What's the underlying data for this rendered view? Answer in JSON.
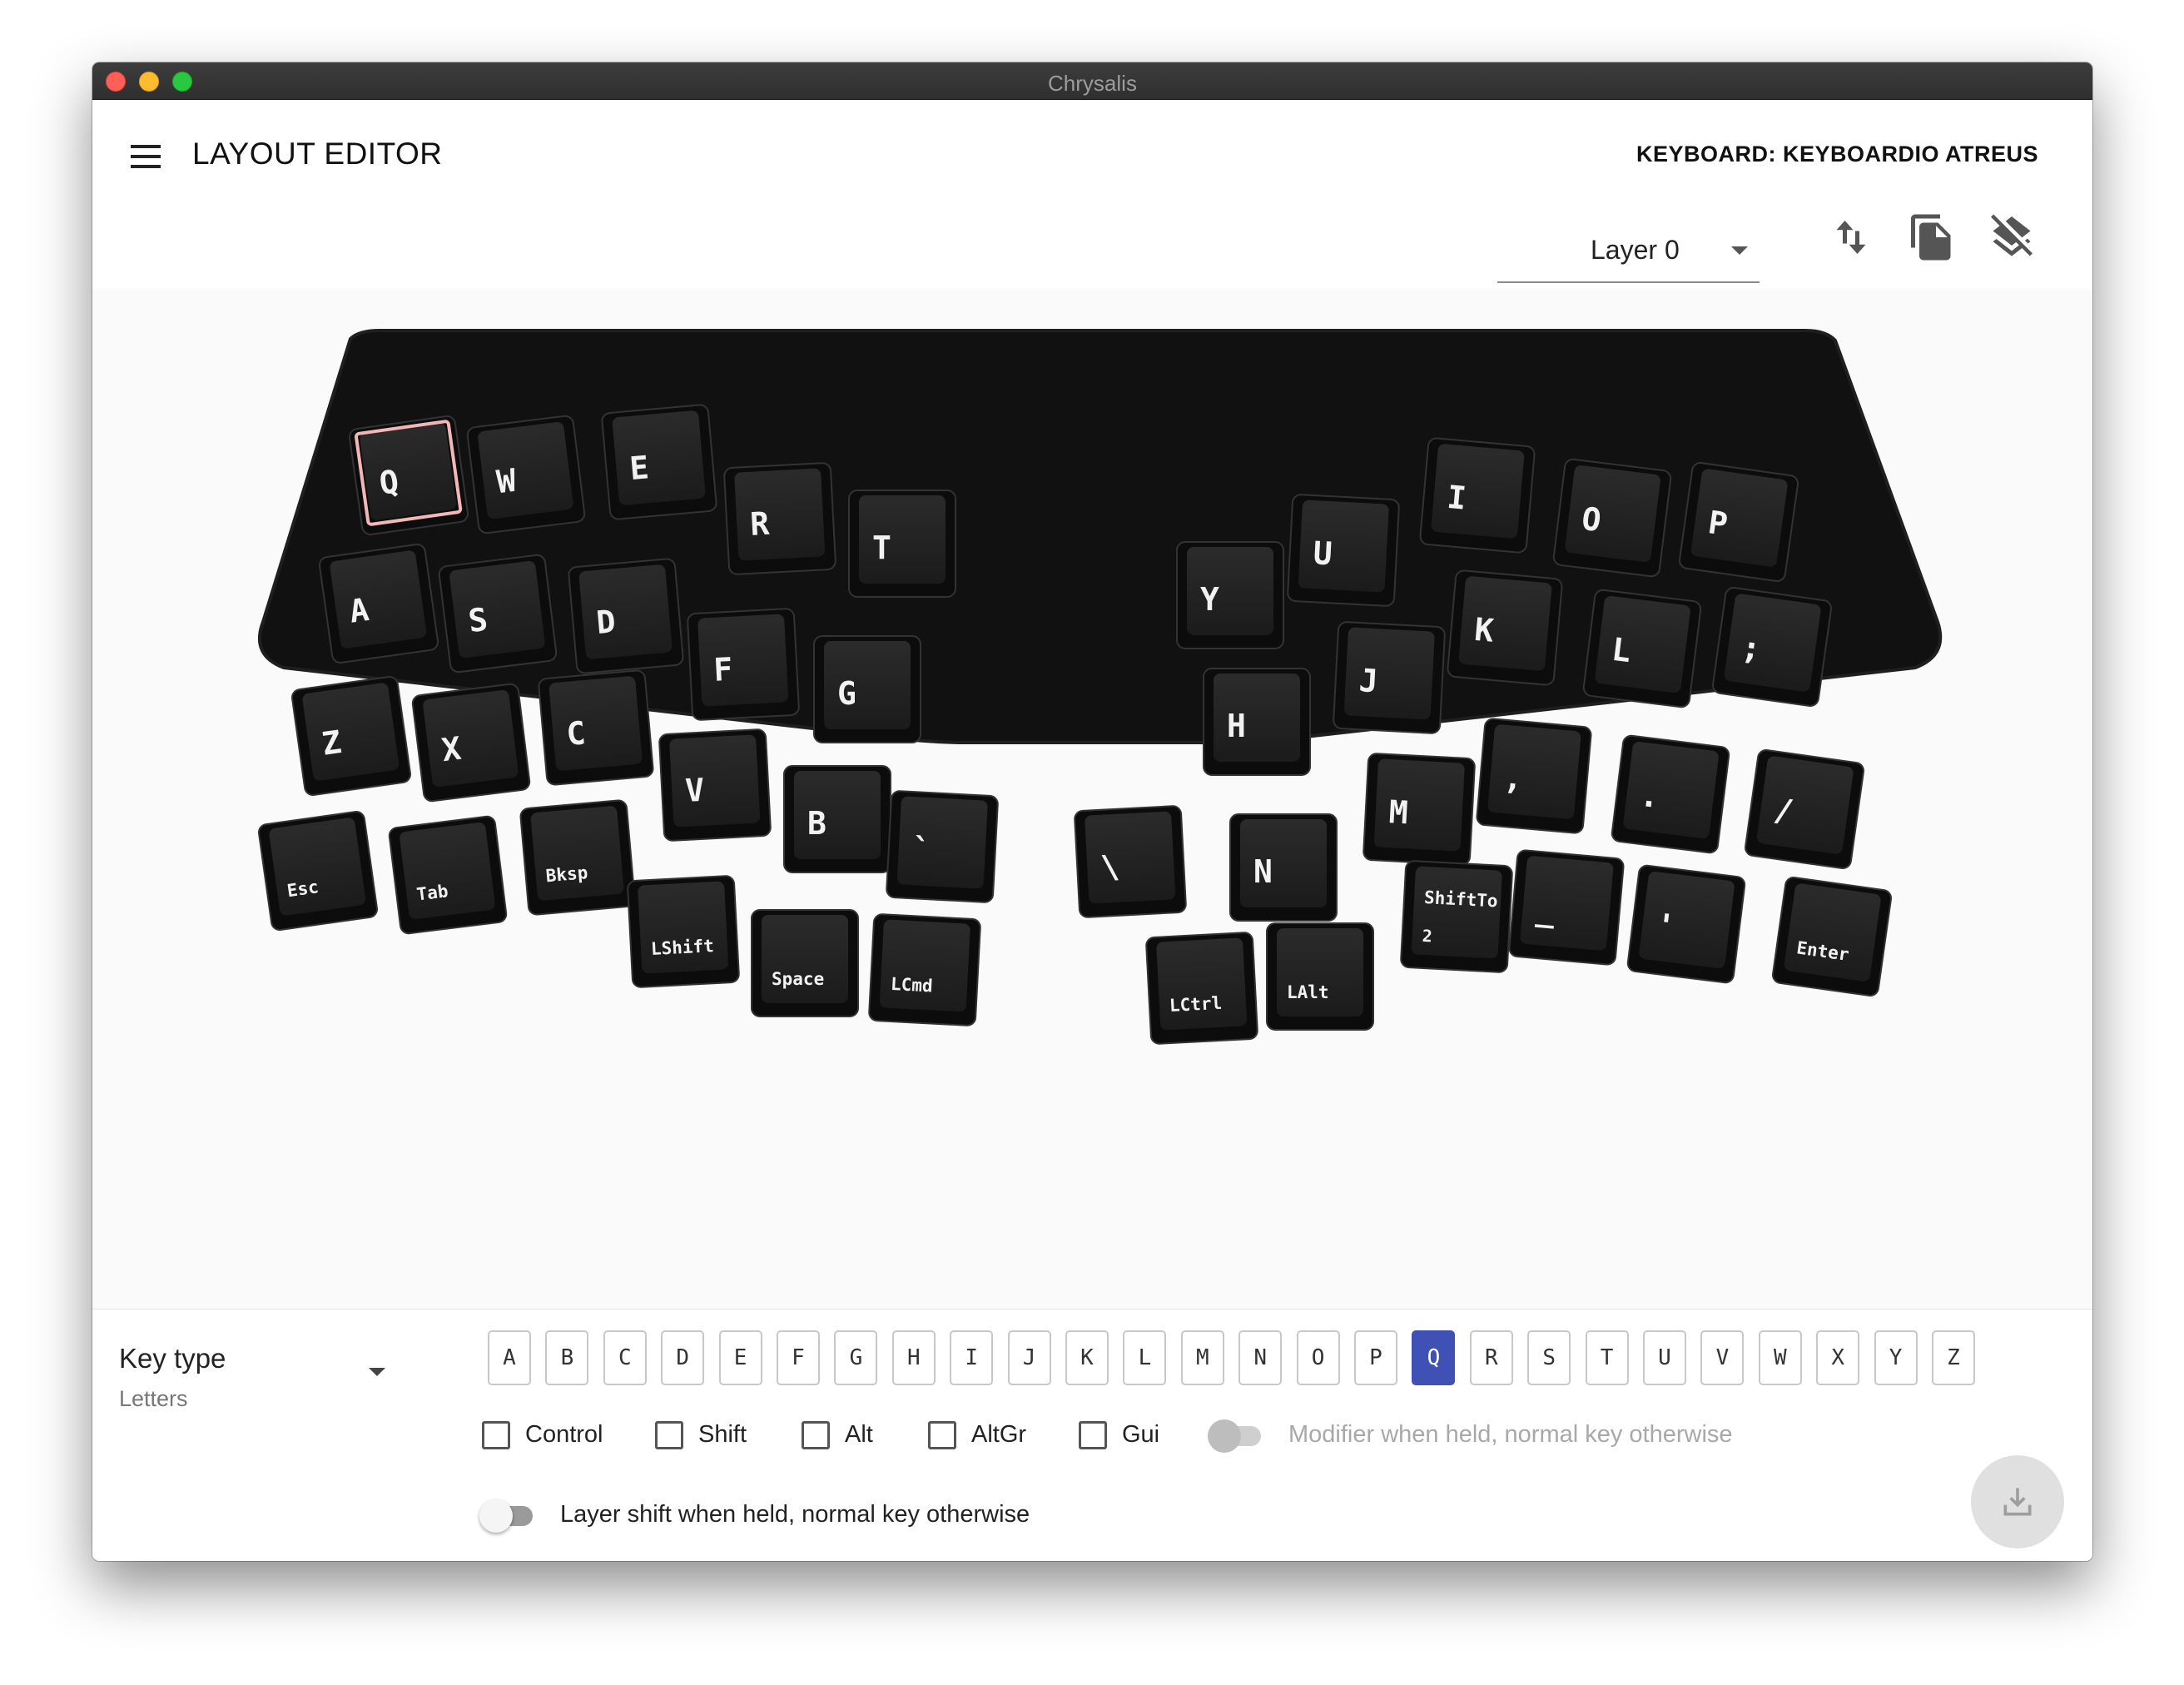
{
  "window": {
    "title": "Chrysalis"
  },
  "header": {
    "title": "LAYOUT EDITOR",
    "keyboard_label": "KEYBOARD: KEYBOARDIO ATREUS",
    "layer_select": {
      "value": "Layer 0"
    },
    "tools": [
      {
        "name": "swap-icon"
      },
      {
        "name": "copy-icon"
      },
      {
        "name": "clear-layer-icon"
      }
    ]
  },
  "keyboard": {
    "selected_key": "Q",
    "keys": [
      {
        "label": "Q",
        "size": "big"
      },
      {
        "label": "W",
        "size": "big"
      },
      {
        "label": "E",
        "size": "big"
      },
      {
        "label": "R",
        "size": "big"
      },
      {
        "label": "T",
        "size": "big"
      },
      {
        "label": "A",
        "size": "big"
      },
      {
        "label": "S",
        "size": "big"
      },
      {
        "label": "D",
        "size": "big"
      },
      {
        "label": "F",
        "size": "big"
      },
      {
        "label": "G",
        "size": "big"
      },
      {
        "label": "Z",
        "size": "big"
      },
      {
        "label": "X",
        "size": "big"
      },
      {
        "label": "C",
        "size": "big"
      },
      {
        "label": "V",
        "size": "big"
      },
      {
        "label": "B",
        "size": "big"
      },
      {
        "label": "`",
        "size": "big"
      },
      {
        "label": "Esc",
        "size": "small"
      },
      {
        "label": "Tab",
        "size": "small"
      },
      {
        "label": "Bksp",
        "size": "small"
      },
      {
        "label": "LShift",
        "size": "small"
      },
      {
        "label": "Space",
        "size": "small"
      },
      {
        "label": "LCmd",
        "size": "small"
      },
      {
        "label": "Y",
        "size": "big"
      },
      {
        "label": "U",
        "size": "big"
      },
      {
        "label": "I",
        "size": "big"
      },
      {
        "label": "O",
        "size": "big"
      },
      {
        "label": "P",
        "size": "big"
      },
      {
        "label": "H",
        "size": "big"
      },
      {
        "label": "J",
        "size": "big"
      },
      {
        "label": "K",
        "size": "big"
      },
      {
        "label": "L",
        "size": "big"
      },
      {
        "label": ";",
        "size": "big"
      },
      {
        "label": "\\",
        "size": "big"
      },
      {
        "label": "N",
        "size": "big"
      },
      {
        "label": "M",
        "size": "big"
      },
      {
        "label": ",",
        "size": "big"
      },
      {
        "label": ".",
        "size": "big"
      },
      {
        "label": "/",
        "size": "big"
      },
      {
        "label": "LCtrl",
        "size": "small"
      },
      {
        "label": "LAlt",
        "size": "small"
      },
      {
        "label": "ShiftTo",
        "sub": "2",
        "size": "small"
      },
      {
        "label": "_",
        "size": "big"
      },
      {
        "label": "'",
        "size": "big"
      },
      {
        "label": "Enter",
        "size": "small"
      }
    ]
  },
  "editor": {
    "key_type": {
      "label": "Key type",
      "value": "Letters"
    },
    "letters": [
      "A",
      "B",
      "C",
      "D",
      "E",
      "F",
      "G",
      "H",
      "I",
      "J",
      "K",
      "L",
      "M",
      "N",
      "O",
      "P",
      "Q",
      "R",
      "S",
      "T",
      "U",
      "V",
      "W",
      "X",
      "Y",
      "Z"
    ],
    "selected_letter": "Q",
    "modifiers": [
      {
        "label": "Control",
        "checked": false
      },
      {
        "label": "Shift",
        "checked": false
      },
      {
        "label": "Alt",
        "checked": false
      },
      {
        "label": "AltGr",
        "checked": false
      },
      {
        "label": "Gui",
        "checked": false
      }
    ],
    "dual_use_modifier": {
      "label": "Modifier when held, normal key otherwise",
      "on": false,
      "disabled": true
    },
    "dual_use_layer": {
      "label": "Layer shift when held, normal key otherwise",
      "on": false
    },
    "save_button": {
      "icon": "download-icon"
    },
    "colors": {
      "accent": "#3f51b5",
      "selected_key_outline": "#f4b6b6"
    }
  }
}
